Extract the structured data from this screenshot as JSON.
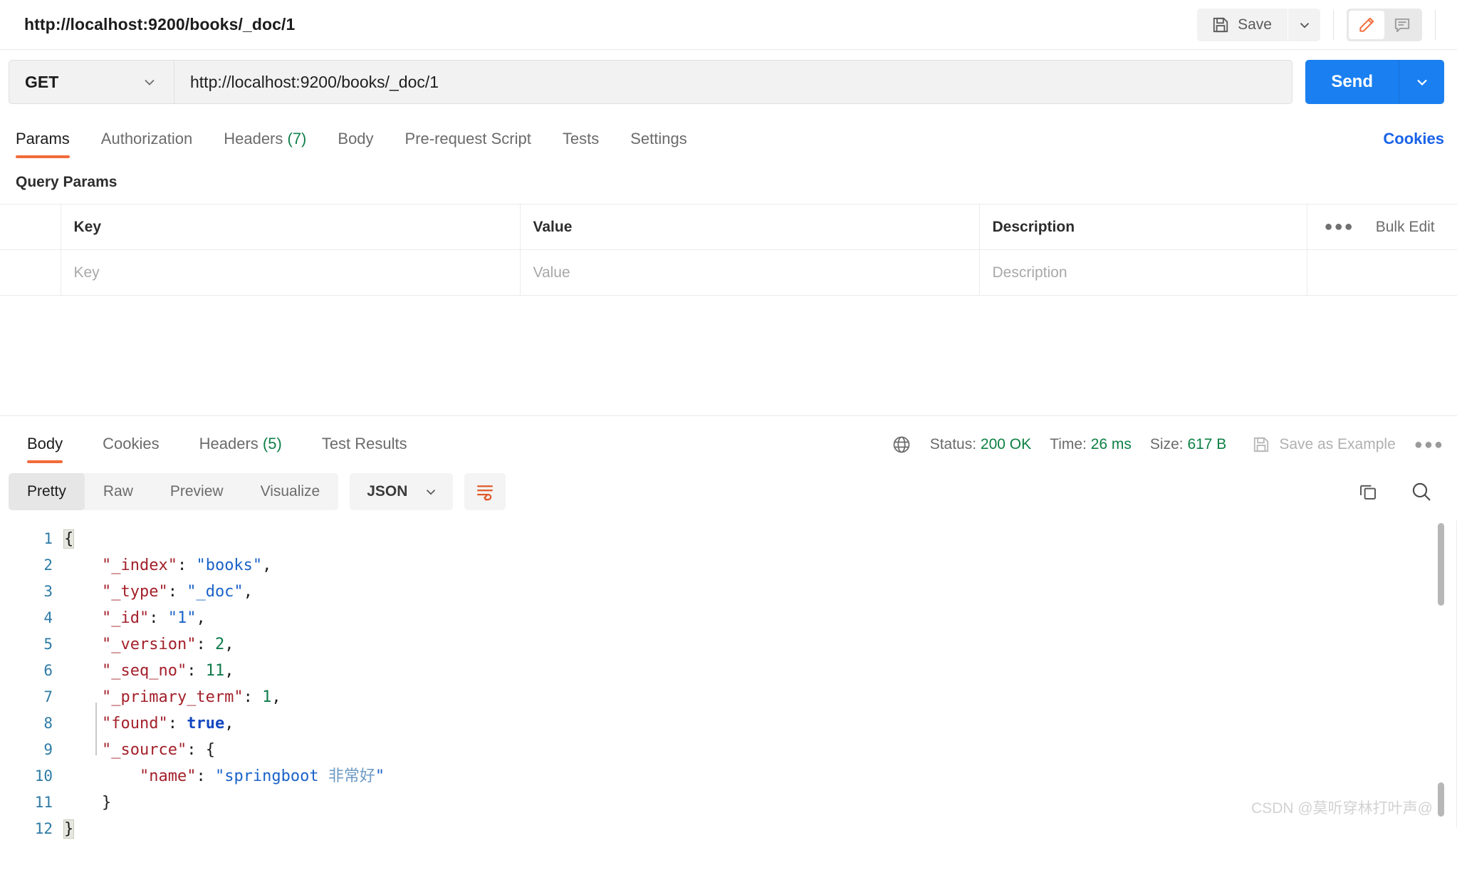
{
  "topbar": {
    "request_title": "http://localhost:9200/books/_doc/1",
    "save_label": "Save",
    "save_icon": "floppy-disk-icon",
    "save_caret_icon": "chevron-down-icon",
    "edit_icon": "pencil-icon",
    "comment_icon": "comment-icon"
  },
  "request": {
    "method": "GET",
    "method_caret_icon": "chevron-down-icon",
    "url": "http://localhost:9200/books/_doc/1",
    "send_label": "Send",
    "send_caret_icon": "chevron-down-icon",
    "accent_blue": "#1a7ff0"
  },
  "request_tabs": [
    {
      "label": "Params",
      "count": "",
      "active": true
    },
    {
      "label": "Authorization",
      "count": "",
      "active": false
    },
    {
      "label": "Headers",
      "count": "(7)",
      "active": false
    },
    {
      "label": "Body",
      "count": "",
      "active": false
    },
    {
      "label": "Pre-request Script",
      "count": "",
      "active": false
    },
    {
      "label": "Tests",
      "count": "",
      "active": false
    },
    {
      "label": "Settings",
      "count": "",
      "active": false
    }
  ],
  "cookies_link": "Cookies",
  "query_params": {
    "section_title": "Query Params",
    "headers": {
      "key": "Key",
      "value": "Value",
      "description": "Description"
    },
    "bulk_edit_label": "Bulk Edit",
    "more_icon": "ellipsis-icon",
    "row_placeholders": {
      "key": "Key",
      "value": "Value",
      "description": "Description"
    }
  },
  "response_tabs": [
    {
      "label": "Body",
      "count": "",
      "active": true
    },
    {
      "label": "Cookies",
      "count": "",
      "active": false
    },
    {
      "label": "Headers",
      "count": "(5)",
      "active": false
    },
    {
      "label": "Test Results",
      "count": "",
      "active": false
    }
  ],
  "response_meta": {
    "globe_icon": "globe-icon",
    "status_label": "Status:",
    "status_value": "200 OK",
    "time_label": "Time:",
    "time_value": "26 ms",
    "size_label": "Size:",
    "size_value": "617 B",
    "save_example_label": "Save as Example",
    "save_example_icon": "floppy-disk-icon",
    "more_icon": "ellipsis-icon",
    "ok_color": "#0d8043"
  },
  "body_toolbar": {
    "views": [
      {
        "label": "Pretty",
        "active": true
      },
      {
        "label": "Raw",
        "active": false
      },
      {
        "label": "Preview",
        "active": false
      },
      {
        "label": "Visualize",
        "active": false
      }
    ],
    "format": "JSON",
    "format_caret_icon": "chevron-down-icon",
    "wrap_icon": "word-wrap-icon",
    "copy_icon": "copy-icon",
    "search_icon": "search-icon"
  },
  "response_body": {
    "line_numbers": [
      "1",
      "2",
      "3",
      "4",
      "5",
      "6",
      "7",
      "8",
      "9",
      "10",
      "11",
      "12"
    ],
    "lines": [
      {
        "n": 1,
        "indent": 0,
        "segments": [
          {
            "t": "{",
            "c": "punc-hl"
          }
        ]
      },
      {
        "n": 2,
        "indent": 1,
        "segments": [
          {
            "t": "\"_index\"",
            "c": "key"
          },
          {
            "t": ": ",
            "c": "punc"
          },
          {
            "t": "\"books\"",
            "c": "str"
          },
          {
            "t": ",",
            "c": "punc"
          }
        ]
      },
      {
        "n": 3,
        "indent": 1,
        "segments": [
          {
            "t": "\"_type\"",
            "c": "key"
          },
          {
            "t": ": ",
            "c": "punc"
          },
          {
            "t": "\"_doc\"",
            "c": "str"
          },
          {
            "t": ",",
            "c": "punc"
          }
        ]
      },
      {
        "n": 4,
        "indent": 1,
        "segments": [
          {
            "t": "\"_id\"",
            "c": "key"
          },
          {
            "t": ": ",
            "c": "punc"
          },
          {
            "t": "\"1\"",
            "c": "str"
          },
          {
            "t": ",",
            "c": "punc"
          }
        ]
      },
      {
        "n": 5,
        "indent": 1,
        "segments": [
          {
            "t": "\"_version\"",
            "c": "key"
          },
          {
            "t": ": ",
            "c": "punc"
          },
          {
            "t": "2",
            "c": "num"
          },
          {
            "t": ",",
            "c": "punc"
          }
        ]
      },
      {
        "n": 6,
        "indent": 1,
        "segments": [
          {
            "t": "\"_seq_no\"",
            "c": "key"
          },
          {
            "t": ": ",
            "c": "punc"
          },
          {
            "t": "11",
            "c": "num"
          },
          {
            "t": ",",
            "c": "punc"
          }
        ]
      },
      {
        "n": 7,
        "indent": 1,
        "segments": [
          {
            "t": "\"_primary_term\"",
            "c": "key"
          },
          {
            "t": ": ",
            "c": "punc"
          },
          {
            "t": "1",
            "c": "num"
          },
          {
            "t": ",",
            "c": "punc"
          }
        ]
      },
      {
        "n": 8,
        "indent": 1,
        "segments": [
          {
            "t": "\"found\"",
            "c": "key"
          },
          {
            "t": ": ",
            "c": "punc"
          },
          {
            "t": "true",
            "c": "bool"
          },
          {
            "t": ",",
            "c": "punc"
          }
        ]
      },
      {
        "n": 9,
        "indent": 1,
        "segments": [
          {
            "t": "\"_source\"",
            "c": "key"
          },
          {
            "t": ": ",
            "c": "punc"
          },
          {
            "t": "{",
            "c": "punc"
          }
        ]
      },
      {
        "n": 10,
        "indent": 2,
        "segments": [
          {
            "t": "\"name\"",
            "c": "key"
          },
          {
            "t": ": ",
            "c": "punc"
          },
          {
            "t": "\"springboot ",
            "c": "str"
          },
          {
            "t": "非常好",
            "c": "cn"
          },
          {
            "t": "\"",
            "c": "str"
          }
        ]
      },
      {
        "n": 11,
        "indent": 1,
        "segments": [
          {
            "t": "}",
            "c": "punc"
          }
        ]
      },
      {
        "n": 12,
        "indent": 0,
        "segments": [
          {
            "t": "}",
            "c": "punc-hl"
          }
        ]
      }
    ],
    "raw_text": "{\n    \"_index\": \"books\",\n    \"_type\": \"_doc\",\n    \"_id\": \"1\",\n    \"_version\": 2,\n    \"_seq_no\": 11,\n    \"_primary_term\": 1,\n    \"found\": true,\n    \"_source\": {\n        \"name\": \"springboot 非常好\"\n    }\n}"
  },
  "watermark": "CSDN @莫听穿林打叶声@"
}
